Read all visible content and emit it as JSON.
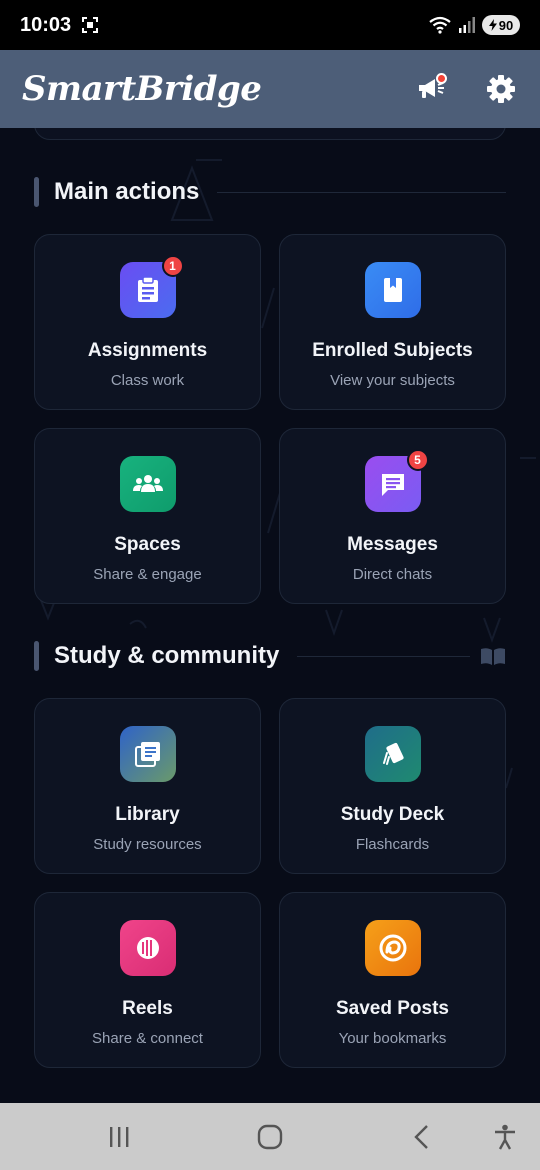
{
  "status_bar": {
    "time": "10:03",
    "battery": "90"
  },
  "appbar": {
    "brand": "SmartBridge"
  },
  "sections": [
    {
      "title": "Main actions",
      "cards": [
        {
          "title": "Assignments",
          "subtitle": "Class work",
          "icon": "clipboard-icon",
          "badge": "1",
          "color": "#5b5bf0"
        },
        {
          "title": "Enrolled Subjects",
          "subtitle": "View your subjects",
          "icon": "book-icon",
          "badge": "",
          "color": "#3b7ff5"
        },
        {
          "title": "Spaces",
          "subtitle": "Share & engage",
          "icon": "group-icon",
          "badge": "",
          "color": "#16b07a"
        },
        {
          "title": "Messages",
          "subtitle": "Direct chats",
          "icon": "chat-icon",
          "badge": "5",
          "color": "#8a55f0"
        }
      ]
    },
    {
      "title": "Study & community",
      "trailing_icon": "open-book-icon",
      "cards": [
        {
          "title": "Library",
          "subtitle": "Study resources",
          "icon": "library-icon",
          "badge": "",
          "color": "#3c74c9"
        },
        {
          "title": "Study Deck",
          "subtitle": "Flashcards",
          "icon": "cards-icon",
          "badge": "",
          "color": "#1e7d78"
        },
        {
          "title": "Reels",
          "subtitle": "Share & connect",
          "icon": "reels-icon",
          "badge": "",
          "color": "#e6367e"
        },
        {
          "title": "Saved Posts",
          "subtitle": "Your bookmarks",
          "icon": "bookmark-swirl-icon",
          "badge": "",
          "color": "#f08c12"
        }
      ]
    }
  ]
}
